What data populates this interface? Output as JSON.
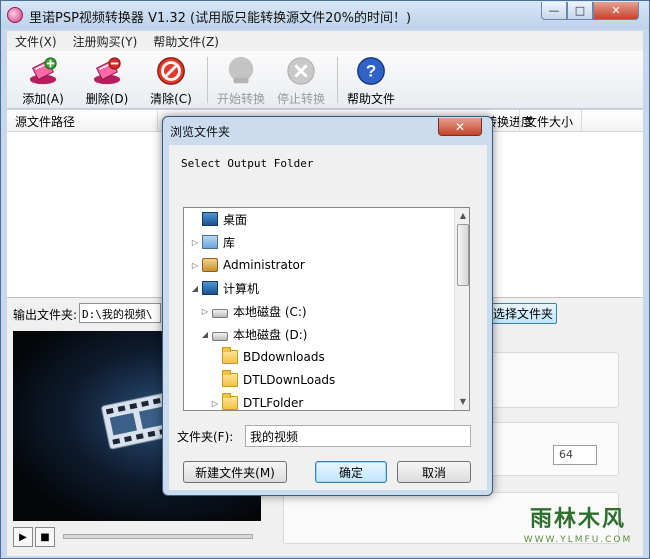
{
  "app": {
    "title": "里诺PSP视频转换器 V1.32 (试用版只能转换源文件20%的时间！)"
  },
  "window_controls": {
    "minimize": "—",
    "maximize": "□",
    "close": "✕"
  },
  "menu": [
    "文件(X)",
    "注册购买(Y)",
    "帮助文件(Z)"
  ],
  "toolbar": {
    "add": "添加(A)",
    "delete": "删除(D)",
    "clear": "清除(C)",
    "start": "开始转换",
    "stop": "停止转换",
    "help": "帮助文件"
  },
  "columns": [
    "源文件路径",
    "转换进度",
    "文件大小"
  ],
  "output": {
    "label": "输出文件夹:",
    "value": "D:\\我的视频\\",
    "choose_button": "选择文件夹"
  },
  "right_panel": {
    "number": "64"
  },
  "dialog": {
    "title": "浏览文件夹",
    "close": "✕",
    "description": "Select Output Folder",
    "tree": [
      {
        "label": "桌面",
        "icon": "desktop-icon",
        "arrow": ""
      },
      {
        "label": "库",
        "icon": "library-icon",
        "arrow": "▷"
      },
      {
        "label": "Administrator",
        "icon": "user-folder-icon",
        "arrow": "▷"
      },
      {
        "label": "计算机",
        "icon": "computer-icon",
        "arrow": "◢"
      },
      {
        "label": "本地磁盘 (C:)",
        "icon": "drive-c-icon",
        "arrow": "▷"
      },
      {
        "label": "本地磁盘 (D:)",
        "icon": "drive-d-icon",
        "arrow": "◢"
      },
      {
        "label": "BDdownloads",
        "icon": "folder-icon",
        "arrow": ""
      },
      {
        "label": "DTLDownLoads",
        "icon": "folder-icon",
        "arrow": ""
      },
      {
        "label": "DTLFolder",
        "icon": "folder-icon",
        "arrow": "▷"
      }
    ],
    "folder_label": "文件夹(F):",
    "folder_value": "我的视频",
    "new_folder": "新建文件夹(M)",
    "ok": "确定",
    "cancel": "取消"
  },
  "watermark": {
    "title": "雨林木风",
    "url": "WWW.YLMFU.COM"
  }
}
